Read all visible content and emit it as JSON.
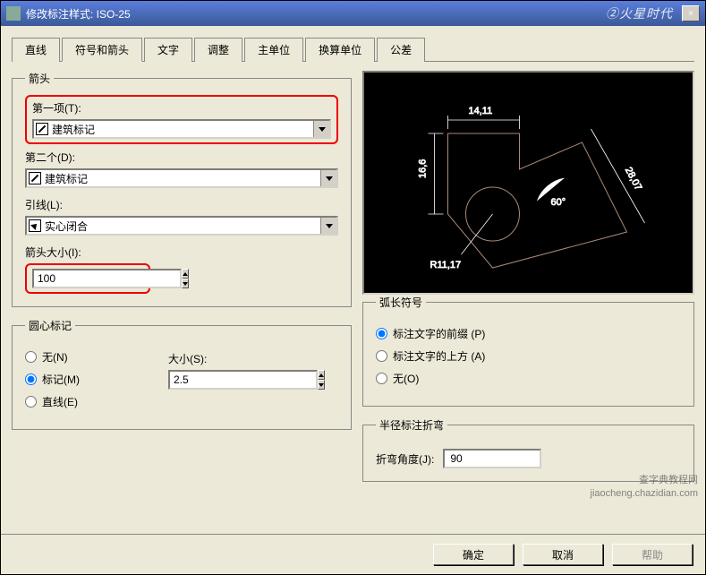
{
  "titlebar": {
    "title": "修改标注样式: ISO-25",
    "watermark": "②火星时代",
    "watermark_url": "www.hxsd.com",
    "close": "×"
  },
  "tabs": {
    "items": [
      {
        "label": "直线"
      },
      {
        "label": "符号和箭头"
      },
      {
        "label": "文字"
      },
      {
        "label": "调整"
      },
      {
        "label": "主单位"
      },
      {
        "label": "换算单位"
      },
      {
        "label": "公差"
      }
    ]
  },
  "arrowheads": {
    "legend": "箭头",
    "first_label": "第一项(T):",
    "first_value": "建筑标记",
    "second_label": "第二个(D):",
    "second_value": "建筑标记",
    "leader_label": "引线(L):",
    "leader_value": "实心闭合",
    "size_label": "箭头大小(I):",
    "size_value": "100"
  },
  "center_marks": {
    "legend": "圆心标记",
    "none": "无(N)",
    "mark": "标记(M)",
    "line": "直线(E)",
    "size_label": "大小(S):",
    "size_value": "2.5"
  },
  "arc": {
    "legend": "弧长符号",
    "preceding": "标注文字的前缀 (P)",
    "above": "标注文字的上方 (A)",
    "none": "无(O)"
  },
  "jog": {
    "legend": "半径标注折弯",
    "label": "折弯角度(J):",
    "value": "90"
  },
  "preview": {
    "dim1": "14,11",
    "dim2": "16,6",
    "dim3": "28,07",
    "dim4": "60°",
    "dim5": "R11,17"
  },
  "buttons": {
    "ok": "确定",
    "cancel": "取消",
    "help": "帮助"
  },
  "corner": {
    "line1": "查字典教程网",
    "line2": "jiaocheng.chazidian.com"
  }
}
